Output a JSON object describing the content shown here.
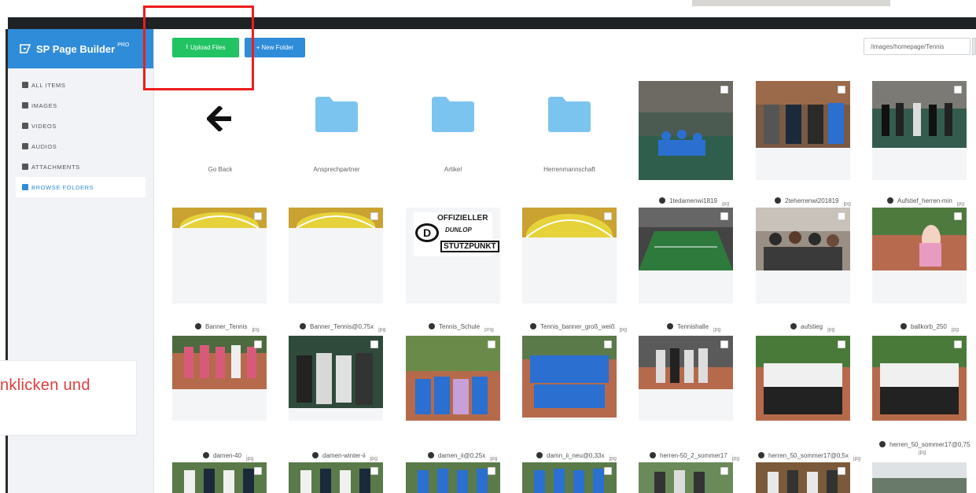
{
  "sidebar": {
    "brand": "SP Page Builder",
    "brand_badge": "PRO",
    "items": [
      {
        "label": "ALL ITEMS",
        "icon": "gear-icon",
        "active": false
      },
      {
        "label": "IMAGES",
        "icon": "image-icon",
        "active": false
      },
      {
        "label": "VIDEOS",
        "icon": "video-icon",
        "active": false
      },
      {
        "label": "AUDIOS",
        "icon": "music-icon",
        "active": false
      },
      {
        "label": "ATTACHMENTS",
        "icon": "paperclip-icon",
        "active": false
      },
      {
        "label": "BROWSE FOLDERS",
        "icon": "folder-open-icon",
        "active": true
      }
    ]
  },
  "toolbar": {
    "upload_label": "Upload Files",
    "new_folder_label": "New Folder",
    "path_value": "/images/homepage/Tennis"
  },
  "caption_text": "nklicken und",
  "folders": [
    {
      "name": "Go Back",
      "type": "back"
    },
    {
      "name": "Ansprechpartner",
      "type": "folder"
    },
    {
      "name": "Artikel",
      "type": "folder"
    },
    {
      "name": "Herrenmannschaft",
      "type": "folder"
    }
  ],
  "images": [
    {
      "name": "1tedamenwi1819",
      "ext": "jpg"
    },
    {
      "name": "2teherrenwi201819",
      "ext": "jpg"
    },
    {
      "name": "Aufstief_herren-min",
      "ext": "jpg"
    },
    {
      "name": "Banner_Tennis",
      "ext": "jpg"
    },
    {
      "name": "Banner_Tennis@0,75x",
      "ext": "jpg"
    },
    {
      "name": "Tennis_Schule",
      "ext": "png"
    },
    {
      "name": "Tennis_banner_groß_weiß",
      "ext": "jpg"
    },
    {
      "name": "Tennishalle",
      "ext": "jpg"
    },
    {
      "name": "aufstieg",
      "ext": "jpg"
    },
    {
      "name": "ballkorb_250",
      "ext": "jpg"
    },
    {
      "name": "damen-40",
      "ext": "jpg"
    },
    {
      "name": "damen-winter-ii",
      "ext": "jpg"
    },
    {
      "name": "damen_ii@0,25x",
      "ext": "jpg"
    },
    {
      "name": "damn_ii_neu@0,33x",
      "ext": "jpg"
    },
    {
      "name": "herren-50_2_sommer17",
      "ext": "jpg"
    },
    {
      "name": "herren_50_sommer17@0,5x",
      "ext": "jpg"
    },
    {
      "name": "herren_50_sommer17@0,75",
      "ext": "jpg"
    }
  ],
  "tennis_school_logo": {
    "line1": "OFFIZIELLER",
    "line2": "DUNLOP",
    "line3": "STÜTZPUNKT"
  },
  "colors": {
    "brand_blue": "#2f8cd8",
    "upload_green": "#21c363",
    "folder_blue": "#7cc4f0",
    "highlight_red": "#ee1c1c"
  }
}
